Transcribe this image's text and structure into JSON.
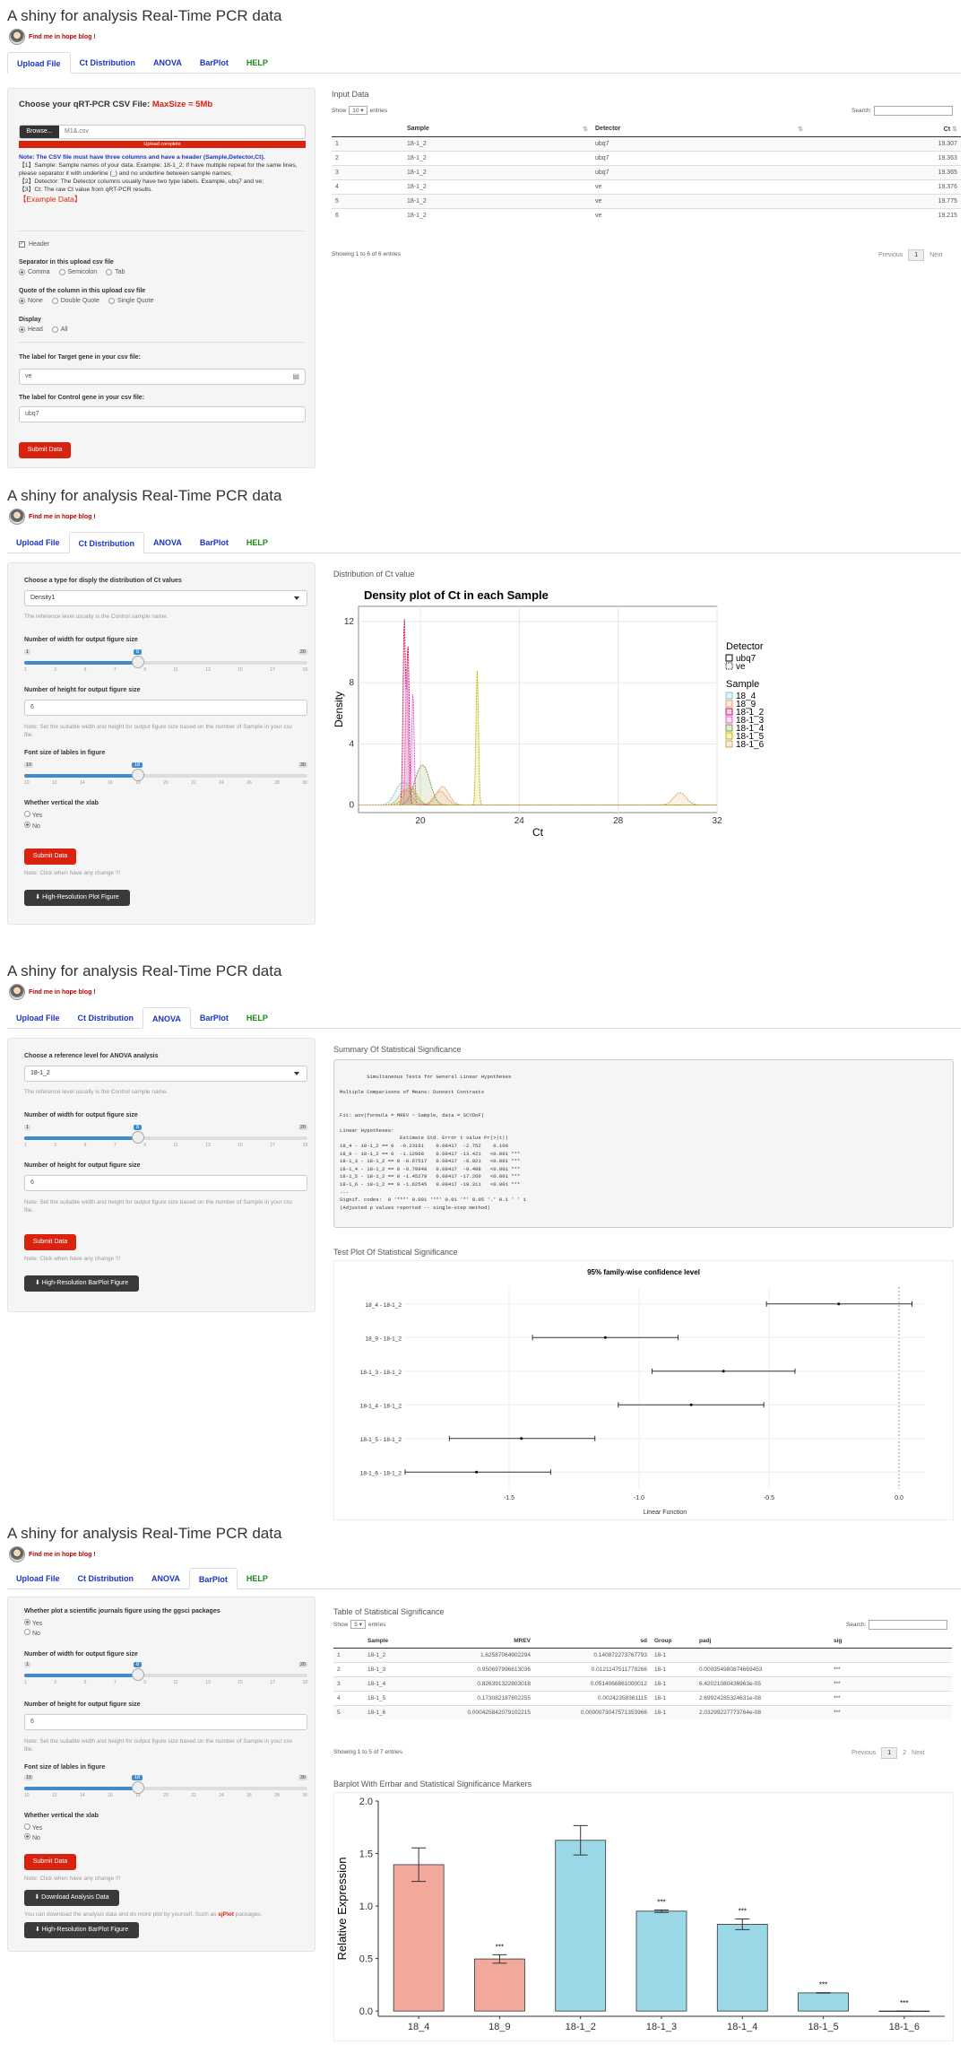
{
  "app": {
    "title": "A shiny for analysis Real-Time PCR data",
    "blog_link": "Find me in hope blog !"
  },
  "tabs": [
    "Upload File",
    "Ct Distribution",
    "ANOVA",
    "BarPlot",
    "HELP"
  ],
  "upload": {
    "file_label_prefix": "Choose your qRT-PCR CSV File: ",
    "file_label_max": "MaxSize = 5Mb",
    "browse_label": "Browse...",
    "file_name": "M1&.csv",
    "progress_text": "Upload complete",
    "note_title": "Note: The CSV file must have three columns and have a header (Sample,Detector,Ct).",
    "note_lines": [
      "【1】Sample: Sample names of your data. Example: 18-1_2; If have multiple repeat for the same lines, please separator it with underline (_) and no underline between sample names;",
      "【2】Detector: The Detector columns usually have two type labels. Example, ubq7 and ve;",
      "【3】Ct: The raw Ct value from qRT-PCR results."
    ],
    "example_link": "【Example Data】",
    "header_label": "Header",
    "separator_label": "Separator in this upload csv file",
    "separator_options": [
      "Comma",
      "Semicolon",
      "Tab"
    ],
    "quote_label": "Quote of the column in this upload csv file",
    "quote_options": [
      "None",
      "Double Quote",
      "Single Quote"
    ],
    "display_label": "Display",
    "display_options": [
      "Head",
      "All"
    ],
    "target_label": "The label for Target gene in your csv file:",
    "target_value": "ve",
    "control_label": "The label for Control gene in your csv file:",
    "control_value": "ubq7",
    "submit_label": "Submit Data",
    "input_title": "Input Data",
    "show_label": "Show",
    "show_value": "10",
    "entries_label": "entries",
    "search_label": "Search:",
    "columns": [
      "",
      "Sample",
      "Detector",
      "Ct"
    ],
    "rows": [
      [
        "1",
        "18-1_2",
        "ubq7",
        "19.307"
      ],
      [
        "2",
        "18-1_2",
        "ubq7",
        "19.363"
      ],
      [
        "3",
        "18-1_2",
        "ubq7",
        "19.365"
      ],
      [
        "4",
        "18-1_2",
        "ve",
        "19.376"
      ],
      [
        "5",
        "18-1_2",
        "ve",
        "19.775"
      ],
      [
        "6",
        "18-1_2",
        "ve",
        "19.215"
      ]
    ],
    "info": "Showing 1 to 6 of 6 entries",
    "prev": "Previous",
    "page": "1",
    "next": "Next"
  },
  "ctdist": {
    "type_label": "Choose a type for disply the distribution of Ct values",
    "type_value": "Density1",
    "type_note": "The reference level usually is the Control sample name.",
    "width_label": "Number of width for output figure size",
    "width_min": "1",
    "width_max": "20",
    "width_value": "8",
    "width_ticks": [
      "1",
      "3",
      "5",
      "7",
      "9",
      "11",
      "13",
      "15",
      "17",
      "19"
    ],
    "height_label": "Number of height for output figure size",
    "height_value": "6",
    "height_note": "Note: Set the suitable width and height for output figure size based on the number of Sample in your csv file.",
    "font_label": "Font size of lables in figure",
    "font_min": "10",
    "font_max": "30",
    "font_value": "18",
    "font_ticks": [
      "10",
      "12",
      "14",
      "16",
      "18",
      "20",
      "22",
      "24",
      "26",
      "28",
      "30"
    ],
    "vertical_label": "Whether vertical the xlab",
    "vertical_options": [
      "Yes",
      "No"
    ],
    "submit_label": "Submit Data",
    "submit_note": "Note: Click when have any change !!!",
    "hires_label": "High-Resolution Plot Figure",
    "plot_head": "Distribution of Ct value"
  },
  "anova": {
    "ref_label": "Choose a reference level for ANOVA analysis",
    "ref_value": "18-1_2",
    "ref_note": "The reference level usually is the Control sample name.",
    "width_label": "Number of width for output figure size",
    "height_label": "Number of height for output figure size",
    "height_value": "6",
    "height_note": "Note: Set the suitable width and height for output figure size based on the number of Sample in your csv file.",
    "submit_label": "Submit Data",
    "submit_note": "Note: Click when have any change !!!",
    "hires_label": "High-Resolution BarPlot Figure",
    "summary_head": "Summary Of Statistical Significance",
    "summary_text": "\n         Simultaneous Tests for General Linear Hypotheses\n\nMultiple Comparisons of Means: Dunnett Contrasts\n\n\nFit: aov(formula = MREV ~ Sample, data = SCYDoF)\n\nLinear Hypotheses:\n                    Estimate Std. Error t value Pr(>|t|)\n18_4 - 18-1_2 == 0  -0.23161    0.08417  -2.752    0.100\n18_9 - 18-1_2 == 0  -1.12968    0.08417 -13.421   <0.001 ***\n18-1_3 - 18-1_2 == 0 -0.67517   0.08417  -8.021   <0.001 ***\n18-1_4 - 18-1_2 == 0 -0.79948   0.08417  -9.498   <0.001 ***\n18-1_5 - 18-1_2 == 0 -1.45279   0.08417 -17.260   <0.001 ***\n18-1_6 - 18-1_2 == 0 -1.62545   0.08417 -19.311   <0.001 ***\n---\nSignif. codes:  0 '***' 0.001 '**' 0.01 '*' 0.05 '.' 0.1 ' ' 1\n(Adjusted p values reported -- single-step method)",
    "testplot_head": "Test Plot Of Statistical Significance"
  },
  "barplot": {
    "journal_label": "Whether plot a scientific journals figure using the ggsci packages",
    "journal_options": [
      "Yes",
      "No"
    ],
    "width_label": "Number of width for output figure size",
    "height_label": "Number of height for output figure size",
    "height_value": "6",
    "height_note": "Note: Set the suitable width and height for output figure size based on the number of Sample in your csv file.",
    "font_label": "Font size of lables in figure",
    "vertical_label": "Whether vertical the xlab",
    "vertical_options": [
      "Yes",
      "No"
    ],
    "submit_label": "Submit Data",
    "submit_note": "Note: Click when have any change !!!",
    "download_label": "Download Analysis Data",
    "download_note_prefix": "You can download the analysis data and do more plot by yourself. Such as ",
    "download_note_link": "sjPlot",
    "download_note_suffix": " packages.",
    "hires_label": "High-Resolution BarPlot Figure",
    "table_head": "Table of Statistical Significance",
    "show_label": "Show",
    "show_value": "5",
    "entries_label": "entries",
    "search_label": "Search:",
    "columns": [
      "",
      "Sample",
      "MREV",
      "sd",
      "Group",
      "padj",
      "sig"
    ],
    "rows": [
      [
        "1",
        "18-1_2",
        "1.62587064902294",
        "0.140872273767793",
        "18-1",
        "",
        ""
      ],
      [
        "2",
        "18-1_3",
        "0.950697996613036",
        "0.0121147511778266",
        "18-1",
        "0.000354980874669453",
        "***"
      ],
      [
        "3",
        "18-1_4",
        "0.826391322803018",
        "0.0514066861000012",
        "18-1",
        "6.42021080436963e-05",
        "***"
      ],
      [
        "4",
        "18-1_5",
        "0.173082187602255",
        "0.00242358361115",
        "18-1",
        "2.69924285324631e-08",
        "***"
      ],
      [
        "5",
        "18-1_6",
        "0.000425842079102215",
        "0.0000073047571353966",
        "18-1",
        "2.03299227773764e-08",
        "***"
      ]
    ],
    "info": "Showing 1 to 5 of 7 entries",
    "prev": "Previous",
    "pages": [
      "1",
      "2"
    ],
    "next": "Next",
    "plot_head": "Barplot With Errbar and Statistical Significance Markers"
  },
  "chart_data": [
    {
      "type": "line",
      "title": "Density plot of Ct in each Sample",
      "xlabel": "Ct",
      "ylabel": "Density",
      "xlim": [
        17.5,
        32
      ],
      "ylim": [
        -0.5,
        13
      ],
      "xticks": [
        20,
        24,
        28,
        32
      ],
      "yticks": [
        0,
        4,
        8,
        12
      ],
      "grid": true,
      "legend": "right",
      "legend_detector_title": "Detector",
      "legend_detector": [
        "ubq7",
        "ve"
      ],
      "legend_sample_title": "Sample",
      "series": [
        {
          "name": "18_4",
          "color": "#7fc8c8",
          "peaks": [
            [
              19.2,
              1.2
            ],
            [
              19.6,
              0.8
            ]
          ]
        },
        {
          "name": "18_9",
          "color": "#e0a060",
          "peaks": [
            [
              19.4,
              1.0
            ],
            [
              20.9,
              1.2
            ]
          ]
        },
        {
          "name": "18-1_2",
          "color": "#c2185b",
          "peaks": [
            [
              19.35,
              12.2
            ],
            [
              19.5,
              10.5
            ]
          ]
        },
        {
          "name": "18-1_3",
          "color": "#e35ad2",
          "peaks": [
            [
              19.45,
              9.0
            ],
            [
              19.7,
              7.4
            ]
          ]
        },
        {
          "name": "18-1_4",
          "color": "#7a9a3a",
          "peaks": [
            [
              19.9,
              1.3
            ],
            [
              20.2,
              1.8
            ]
          ]
        },
        {
          "name": "18-1_5",
          "color": "#c8b400",
          "peaks": [
            [
              22.3,
              8.8
            ],
            [
              19.6,
              1.2
            ]
          ]
        },
        {
          "name": "18-1_6",
          "color": "#d4a060",
          "peaks": [
            [
              30.5,
              0.8
            ],
            [
              20.8,
              0.9
            ]
          ]
        }
      ]
    },
    {
      "type": "scatter",
      "title": "95% family-wise confidence level",
      "xlabel": "Linear Function",
      "ylabel": "",
      "xlim": [
        -1.9,
        0.1
      ],
      "xticks": [
        -1.5,
        -1.0,
        -0.5,
        0.0
      ],
      "categories": [
        "18_4 - 18-1_2",
        "18_9 - 18-1_2",
        "18-1_3 - 18-1_2",
        "18-1_4 - 18-1_2",
        "18-1_5 - 18-1_2",
        "18-1_6 - 18-1_2"
      ],
      "estimate": [
        -0.23161,
        -1.12968,
        -0.67517,
        -0.79948,
        -1.45279,
        -1.62545
      ],
      "lower": [
        -0.51,
        -1.41,
        -0.95,
        -1.08,
        -1.73,
        -1.9
      ],
      "upper": [
        0.05,
        -0.85,
        -0.4,
        -0.52,
        -1.17,
        -1.34
      ]
    },
    {
      "type": "bar",
      "title": "",
      "xlabel": "",
      "ylabel": "Relative Expression",
      "ylim": [
        -0.05,
        2.0
      ],
      "yticks": [
        0.0,
        0.5,
        1.0,
        1.5,
        2.0
      ],
      "categories": [
        "18_4",
        "18_9",
        "18-1_2",
        "18-1_3",
        "18-1_4",
        "18-1_5",
        "18-1_6"
      ],
      "values": [
        1.394,
        0.496,
        1.626,
        0.951,
        0.826,
        0.173,
        0.0004
      ],
      "errors": [
        0.16,
        0.04,
        0.14,
        0.012,
        0.051,
        0.0024,
        1e-05
      ],
      "sig": [
        "",
        "***",
        "",
        "***",
        "***",
        "***",
        "***"
      ],
      "colors": [
        "#f3a89c",
        "#f3a89c",
        "#9ad8e8",
        "#9ad8e8",
        "#9ad8e8",
        "#9ad8e8",
        "#9ad8e8"
      ]
    }
  ]
}
